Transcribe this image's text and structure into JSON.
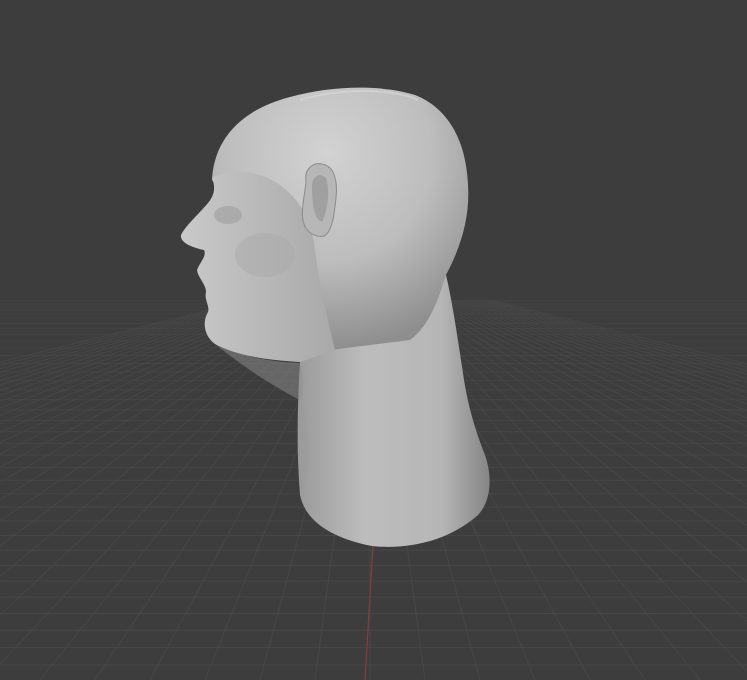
{
  "viewport": {
    "background": "#3d3d3d",
    "grid_color": "#4a4a4a",
    "x_axis_color": "#8b3c3c",
    "model": {
      "object": "head-sculpt",
      "material": "solid-grey",
      "base_color": "#b4b4b4",
      "highlight_color": "#cfcfcf",
      "shadow_color": "#7e7e7e",
      "view": "left-profile"
    }
  }
}
